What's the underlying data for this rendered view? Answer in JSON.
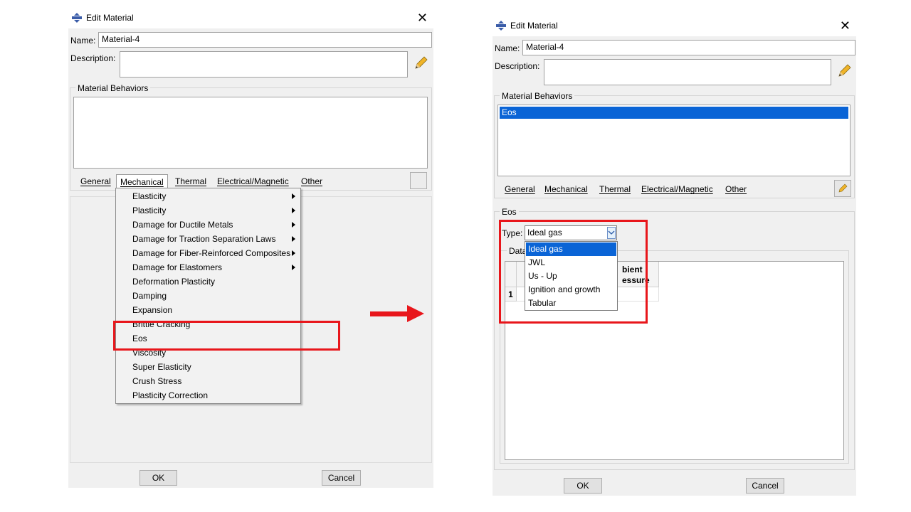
{
  "left_dialog": {
    "title": "Edit Material",
    "close_glyph": "✕",
    "name_label": "Name:",
    "name_value": "Material-4",
    "description_label": "Description:",
    "behaviors_group_label": "Material Behaviors",
    "menus": [
      "General",
      "Mechanical",
      "Thermal",
      "Electrical/Magnetic",
      "Other"
    ],
    "active_menu": "Mechanical",
    "mechanical_menu": [
      {
        "label": "Elasticity",
        "submenu": true
      },
      {
        "label": "Plasticity",
        "submenu": true
      },
      {
        "label": "Damage for Ductile Metals",
        "submenu": true
      },
      {
        "label": "Damage for Traction Separation Laws",
        "submenu": true
      },
      {
        "label": "Damage for Fiber-Reinforced Composites",
        "submenu": true
      },
      {
        "label": "Damage for Elastomers",
        "submenu": true
      },
      {
        "label": "Deformation Plasticity",
        "submenu": false
      },
      {
        "label": "Damping",
        "submenu": false
      },
      {
        "label": "Expansion",
        "submenu": false
      },
      {
        "label": "Brittle Cracking",
        "submenu": false
      },
      {
        "label": "Eos",
        "submenu": false
      },
      {
        "label": "Viscosity",
        "submenu": false
      },
      {
        "label": "Super Elasticity",
        "submenu": false
      },
      {
        "label": "Crush Stress",
        "submenu": false
      },
      {
        "label": "Plasticity Correction",
        "submenu": false
      }
    ],
    "highlighted_item": "Eos",
    "ok_label": "OK",
    "cancel_label": "Cancel"
  },
  "right_dialog": {
    "title": "Edit Material",
    "close_glyph": "✕",
    "name_label": "Name:",
    "name_value": "Material-4",
    "description_label": "Description:",
    "behaviors_group_label": "Material Behaviors",
    "behaviors": [
      "Eos"
    ],
    "menus": [
      "General",
      "Mechanical",
      "Thermal",
      "Electrical/Magnetic",
      "Other"
    ],
    "eos_group_label": "Eos",
    "type_label": "Type:",
    "type_value": "Ideal gas",
    "type_options": [
      "Ideal gas",
      "JWL",
      "Us - Up",
      "Ignition and growth",
      "Tabular"
    ],
    "data_group_label": "Data",
    "table_header_partial_1": "bient",
    "table_header_partial_2": "essure",
    "row_number": "1",
    "ok_label": "OK",
    "cancel_label": "Cancel"
  },
  "colors": {
    "highlight_red": "#e8161b",
    "selection_blue": "#0a64d6",
    "dialog_bg": "#f0f0f0"
  }
}
